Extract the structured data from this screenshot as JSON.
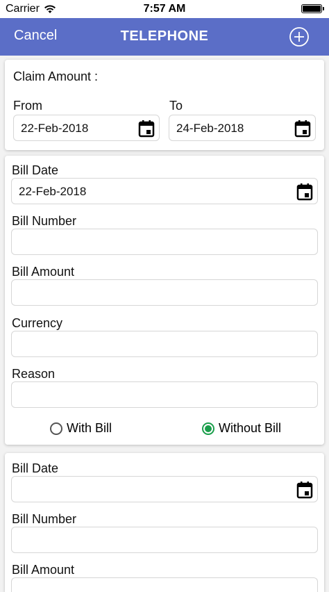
{
  "status_bar": {
    "carrier": "Carrier",
    "time": "7:57 AM"
  },
  "nav": {
    "cancel_label": "Cancel",
    "title": "TELEPHONE"
  },
  "claim": {
    "label": "Claim Amount :",
    "from_label": "From",
    "from_value": "22-Feb-2018",
    "to_label": "To",
    "to_value": "24-Feb-2018"
  },
  "bill_1": {
    "bill_date_label": "Bill Date",
    "bill_date_value": "22-Feb-2018",
    "bill_number_label": "Bill Number",
    "bill_number_value": "",
    "bill_amount_label": "Bill Amount",
    "bill_amount_value": "",
    "currency_label": "Currency",
    "currency_value": "",
    "reason_label": "Reason",
    "reason_value": "",
    "with_bill_label": "With Bill",
    "without_bill_label": "Without Bill",
    "selected_option": "Without Bill"
  },
  "bill_2": {
    "bill_date_label": "Bill Date",
    "bill_date_value": "",
    "bill_number_label": "Bill Number",
    "bill_number_value": "",
    "bill_amount_label": "Bill Amount"
  },
  "colors": {
    "nav_background": "#5b6ec7",
    "radio_selected": "#1a9e4b"
  },
  "icons": {
    "calendar": "calendar-icon",
    "add": "add-circle-icon",
    "wifi": "wifi-icon",
    "battery": "battery-icon"
  }
}
